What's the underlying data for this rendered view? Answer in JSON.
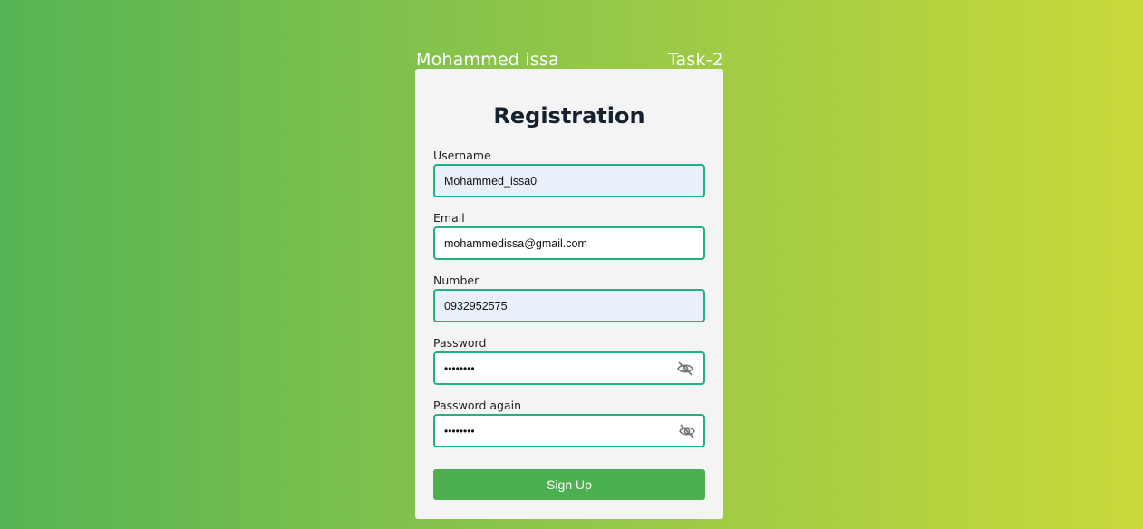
{
  "header": {
    "author": "Mohammed issa",
    "task": "Task-2"
  },
  "form": {
    "title": "Registration",
    "fields": [
      {
        "label": "Username",
        "value": "Mohammed_issa0",
        "type": "text"
      },
      {
        "label": "Email",
        "value": "mohammedissa@gmail.com",
        "type": "email"
      },
      {
        "label": "Number",
        "value": "0932952575",
        "type": "text"
      },
      {
        "label": "Password",
        "value": "••••••••",
        "type": "password"
      },
      {
        "label": "Password again",
        "value": "••••••••",
        "type": "password"
      }
    ],
    "submit_label": "Sign Up"
  },
  "colors": {
    "field_border": "#21b27f",
    "autofill_bg": "#e8f0fb",
    "button_bg": "#4caf50",
    "card_bg": "#f4f4f4"
  },
  "icons": {
    "password_toggle": "eye-slash-icon",
    "password_again_toggle": "eye-slash-icon"
  }
}
